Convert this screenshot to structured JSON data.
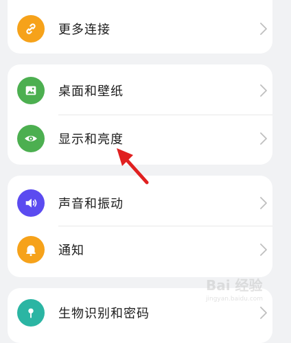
{
  "settings": {
    "more_connections": {
      "label": "更多连接",
      "icon": "link-icon",
      "color": "#f6a21a"
    },
    "desktop_wallpaper": {
      "label": "桌面和壁纸",
      "icon": "image-icon",
      "color": "#4caf50"
    },
    "display_brightness": {
      "label": "显示和亮度",
      "icon": "eye-icon",
      "color": "#4caf50"
    },
    "sound_vibration": {
      "label": "声音和振动",
      "icon": "speaker-icon",
      "color": "#5b4bf0"
    },
    "notifications": {
      "label": "通知",
      "icon": "bell-icon",
      "color": "#f6a21a"
    },
    "biometrics_password": {
      "label": "生物识别和密码",
      "icon": "key-icon",
      "color": "#2bb5a3"
    }
  },
  "annotation": {
    "arrow_color": "#e02020",
    "icon": "arrow-pointer-icon"
  },
  "watermark": {
    "text": "Bai 经验",
    "subtext": "jingyan.baidu.com"
  }
}
